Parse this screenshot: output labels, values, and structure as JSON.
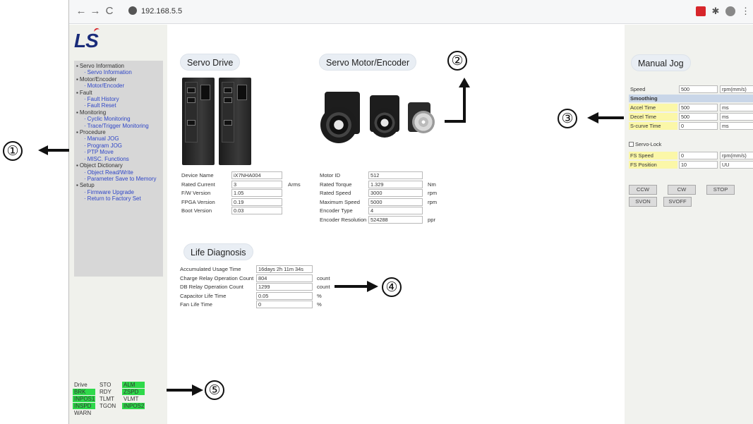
{
  "browser": {
    "url": "192.168.5.5",
    "nav": {
      "back": "←",
      "forward": "→",
      "reload": "C"
    }
  },
  "logo": "LS",
  "sidebar": {
    "menu": [
      {
        "type": "cat",
        "label": "Servo Information"
      },
      {
        "type": "sub",
        "label": "Servo Information"
      },
      {
        "type": "cat",
        "label": "Motor/Encoder"
      },
      {
        "type": "sub",
        "label": "Motor/Encoder"
      },
      {
        "type": "cat",
        "label": "Fault"
      },
      {
        "type": "sub",
        "label": "Fault History"
      },
      {
        "type": "sub",
        "label": "Fault Reset"
      },
      {
        "type": "cat",
        "label": "Monitoring"
      },
      {
        "type": "sub",
        "label": "Cyclic Monitoring"
      },
      {
        "type": "sub",
        "label": "Trace/Trigger Monitoring"
      },
      {
        "type": "cat",
        "label": "Procedure"
      },
      {
        "type": "sub",
        "label": "Manual JOG"
      },
      {
        "type": "sub",
        "label": "Program JOG"
      },
      {
        "type": "sub",
        "label": "PTP Move"
      },
      {
        "type": "sub",
        "label": "MISC. Functions"
      },
      {
        "type": "cat",
        "label": "Object Dictionary"
      },
      {
        "type": "sub",
        "label": "Object Read/Write"
      },
      {
        "type": "sub",
        "label": "Parameter Save to Memory"
      },
      {
        "type": "cat",
        "label": "Setup"
      },
      {
        "type": "sub",
        "label": "Firmware Upgrade"
      },
      {
        "type": "sub",
        "label": "Return to Factory Set"
      }
    ],
    "status": [
      {
        "label": "Drive Enable",
        "active": false
      },
      {
        "label": "STO",
        "active": false
      },
      {
        "label": "ALM",
        "active": true
      },
      {
        "label": "BRK",
        "active": true
      },
      {
        "label": "RDY",
        "active": false
      },
      {
        "label": "ZSPD",
        "active": true
      },
      {
        "label": "INPOS1",
        "active": true
      },
      {
        "label": "TLMT",
        "active": false
      },
      {
        "label": "VLMT",
        "active": false
      },
      {
        "label": "INSPD",
        "active": true
      },
      {
        "label": "TGON",
        "active": false
      },
      {
        "label": "INPOS2",
        "active": true
      },
      {
        "label": "WARN",
        "active": false
      }
    ]
  },
  "servo_drive": {
    "title": "Servo Drive",
    "rows": [
      {
        "label": "Device Name",
        "value": "iX7NHA004",
        "unit": ""
      },
      {
        "label": "Rated Current",
        "value": "3",
        "unit": "Arms"
      },
      {
        "label": "F/W Version",
        "value": "1.05",
        "unit": ""
      },
      {
        "label": "FPGA Version",
        "value": "0.19",
        "unit": ""
      },
      {
        "label": "Boot Version",
        "value": "0.03",
        "unit": ""
      }
    ]
  },
  "servo_motor": {
    "title": "Servo Motor/Encoder",
    "rows": [
      {
        "label": "Motor ID",
        "value": "512",
        "unit": ""
      },
      {
        "label": "Rated Torque",
        "value": "1.329",
        "unit": "Nm"
      },
      {
        "label": "Rated Speed",
        "value": "3000",
        "unit": "rpm"
      },
      {
        "label": "Maximum Speed",
        "value": "5000",
        "unit": "rpm"
      },
      {
        "label": "Encoder Type",
        "value": "4",
        "unit": ""
      },
      {
        "label": "Encoder Resolution",
        "value": "524288",
        "unit": "ppr"
      }
    ]
  },
  "life": {
    "title": "Life Diagnosis",
    "rows": [
      {
        "label": "Accumulated Usage Time",
        "value": "16days 2h 11m 34s",
        "unit": ""
      },
      {
        "label": "Charge Relay Operation Count",
        "value": "804",
        "unit": "count"
      },
      {
        "label": "DB Relay Operation Count",
        "value": "1299",
        "unit": "count"
      },
      {
        "label": "Capacitor Life Time",
        "value": "0.05",
        "unit": "%"
      },
      {
        "label": "Fan Life Time",
        "value": "0",
        "unit": "%"
      }
    ]
  },
  "jog": {
    "title": "Manual Jog",
    "speed": {
      "label": "Speed",
      "value": "500",
      "unit": "rpm(mm/s)"
    },
    "smoothing_header": "Smoothing",
    "smoothing": [
      {
        "label": "Accel Time",
        "value": "500",
        "unit": "ms"
      },
      {
        "label": "Decel Time",
        "value": "500",
        "unit": "ms"
      },
      {
        "label": "S-curve Time",
        "value": "0",
        "unit": "ms"
      }
    ],
    "servo_lock": "Servo-Lock",
    "fs": [
      {
        "label": "FS Speed",
        "value": "0",
        "unit": "rpm(mm/s)"
      },
      {
        "label": "FS Position",
        "value": "10",
        "unit": "UU"
      }
    ],
    "buttons_row1": [
      "CCW",
      "CW",
      "STOP"
    ],
    "buttons_row2": [
      "SVON",
      "SVOFF"
    ]
  },
  "callouts": [
    "①",
    "②",
    "③",
    "④",
    "⑤"
  ]
}
